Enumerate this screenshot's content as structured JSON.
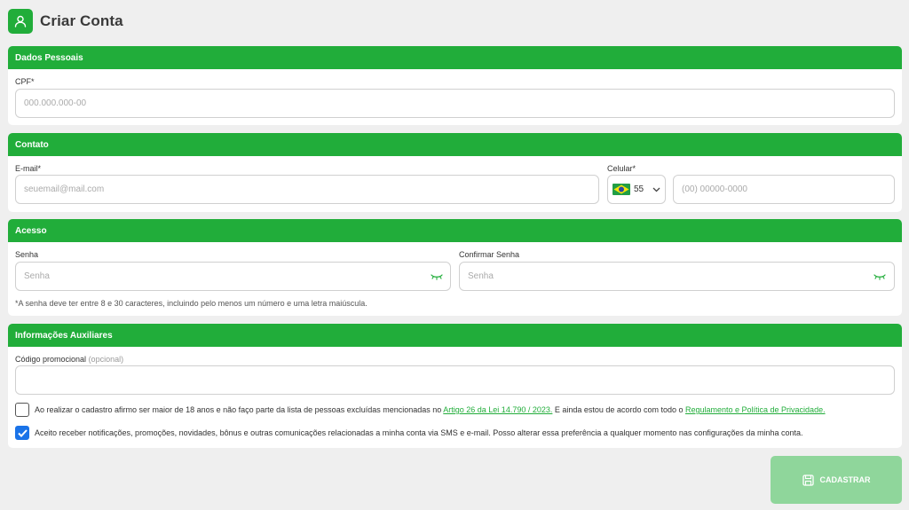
{
  "header": {
    "title": "Criar Conta"
  },
  "pessoais": {
    "title": "Dados Pessoais",
    "cpf_label": "CPF*",
    "cpf_placeholder": "000.000.000-00"
  },
  "contato": {
    "title": "Contato",
    "email_label": "E-mail*",
    "email_placeholder": "seuemail@mail.com",
    "celular_label": "Celular*",
    "country_code": "55",
    "phone_placeholder": "(00) 00000-0000"
  },
  "acesso": {
    "title": "Acesso",
    "senha_label": "Senha",
    "senha_placeholder": "Senha",
    "confirmar_label": "Confirmar Senha",
    "confirmar_placeholder": "Senha",
    "hint": "*A senha deve ter entre 8 e 30 caracteres, incluindo pelo menos um número e uma letra maiúscula."
  },
  "auxiliares": {
    "title": "Informações Auxiliares",
    "promo_label": "Código promocional",
    "promo_optional": "(opcional)",
    "promo_value": "",
    "terms": {
      "checked": false,
      "text_before": "Ao realizar o cadastro afirmo ser maior de 18 anos e não faço parte da lista de pessoas excluídas mencionadas no ",
      "link1": "Artigo 26 da Lei 14.790 / 2023.",
      "text_middle": " E ainda estou de acordo com todo o ",
      "link2": "Regulamento e Política de Privacidade."
    },
    "notifications": {
      "checked": true,
      "text": "Aceito receber notificações, promoções, novidades, bônus e outras comunicações relacionadas a minha conta via SMS e e-mail. Posso alterar essa preferência a qualquer momento nas configurações da minha conta."
    }
  },
  "submit": {
    "label": "CADASTRAR"
  },
  "colors": {
    "brand_green": "#21ad3a",
    "button_disabled": "#8fd69b",
    "checkbox_checked": "#1a73e8",
    "page_bg": "#efefef"
  },
  "icons": {
    "header": "user-icon",
    "password_toggle": "eye-closed-icon",
    "submit": "save-icon",
    "country_dropdown": "chevron-down-icon",
    "flag": "brazil-flag-icon"
  }
}
